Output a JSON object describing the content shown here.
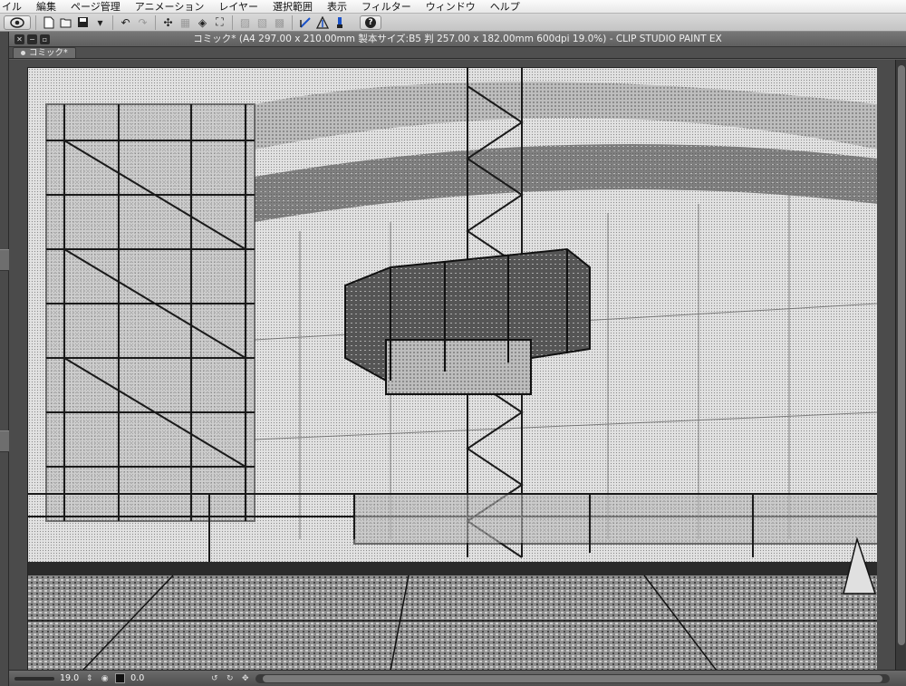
{
  "menu": [
    "イル",
    "編集",
    "ページ管理",
    "アニメーション",
    "レイヤー",
    "選択範囲",
    "表示",
    "フィルター",
    "ウィンドウ",
    "ヘルプ"
  ],
  "command_bar": {
    "icons": [
      "clip-studio-icon",
      "new-icon",
      "open-icon",
      "save-icon",
      "undo-icon",
      "redo-icon",
      "clear-icon",
      "fill-icon",
      "transform-icon",
      "snap-ruler-icon",
      "snap-guide-icon",
      "snap-grid-icon",
      "help-icon"
    ],
    "help_label": "?"
  },
  "window": {
    "title": "コミック* (A4 297.00 x 210.00mm 製本サイズ:B5 判 257.00 x 182.00mm 600dpi 19.0%) - CLIP STUDIO PAINT EX",
    "tab_label": "コミック*"
  },
  "statusbar": {
    "zoom": "19.0",
    "angle": "0.0"
  },
  "colors": {
    "menubar": "#efefef",
    "window_bg": "#5a5a5a",
    "accent_blue": "#1a52c9"
  }
}
